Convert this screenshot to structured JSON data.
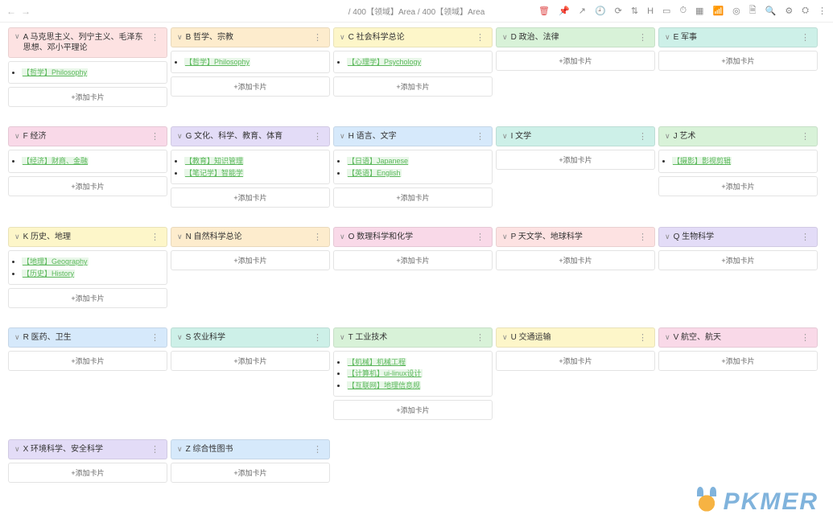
{
  "breadcrumb": {
    "sep": "/",
    "a": "400【领域】Area",
    "b": "400【领域】Area"
  },
  "add_label": "+添加卡片",
  "watermark": "PKMER",
  "toolbar_icons": [
    "trash",
    "pin",
    "share",
    "recent",
    "refresh",
    "sort",
    "h",
    "col",
    "clock",
    "grid",
    "wifi",
    "target",
    "doc",
    "search",
    "gear",
    "settings",
    "more"
  ],
  "lanes": [
    {
      "t": "A 马克思主义、列宁主义、毛泽东思想、邓小平理论",
      "c": "c-red",
      "tall": true,
      "items": [
        {
          "txt": "【哲学】Philosophy"
        }
      ]
    },
    {
      "t": "B 哲学、宗教",
      "c": "c-orange",
      "items": [
        {
          "txt": "【哲学】Philosophy"
        }
      ]
    },
    {
      "t": "C 社会科学总论",
      "c": "c-yellow",
      "items": [
        {
          "txt": "【心理学】Psychology"
        }
      ]
    },
    {
      "t": "D 政治、法律",
      "c": "c-green",
      "items": []
    },
    {
      "t": "E 军事",
      "c": "c-teal",
      "items": []
    },
    {
      "t": "F 经济",
      "c": "c-pink",
      "items": [
        {
          "txt": "【经济】财商、金融"
        }
      ]
    },
    {
      "t": "G 文化、科学、教育、体育",
      "c": "c-purple",
      "items": [
        {
          "txt": "【教育】知识管理"
        },
        {
          "txt": "【笔记学】智能学"
        }
      ]
    },
    {
      "t": "H 语言、文字",
      "c": "c-blue",
      "items": [
        {
          "txt": "【日语】Japanese"
        },
        {
          "txt": "【英语】English"
        }
      ]
    },
    {
      "t": "I 文学",
      "c": "c-teal",
      "items": []
    },
    {
      "t": "J 艺术",
      "c": "c-green",
      "items": [
        {
          "txt": "【摄影】影视剪辑"
        }
      ]
    },
    {
      "t": "K 历史、地理",
      "c": "c-yellow",
      "items": [
        {
          "txt": "【地理】Geography"
        },
        {
          "txt": "【历史】History"
        }
      ]
    },
    {
      "t": "N 自然科学总论",
      "c": "c-orange",
      "items": []
    },
    {
      "t": "O 数理科学和化学",
      "c": "c-pink",
      "items": []
    },
    {
      "t": "P 天文学、地球科学",
      "c": "c-red",
      "items": []
    },
    {
      "t": "Q 生物科学",
      "c": "c-purple",
      "items": []
    },
    {
      "t": "R 医药、卫生",
      "c": "c-blue",
      "items": []
    },
    {
      "t": "S 农业科学",
      "c": "c-teal",
      "items": []
    },
    {
      "t": "T 工业技术",
      "c": "c-green",
      "items": [
        {
          "txt": "【机械】机械工程"
        },
        {
          "txt": "【计算机】ui-linux设计"
        },
        {
          "txt": "【互联网】地理信息规"
        }
      ]
    },
    {
      "t": "U 交通运输",
      "c": "c-yellow",
      "items": []
    },
    {
      "t": "V 航空、航天",
      "c": "c-pink",
      "items": []
    },
    {
      "t": "X 环境科学、安全科学",
      "c": "c-purple",
      "items": []
    },
    {
      "t": "Z 综合性图书",
      "c": "c-blue",
      "items": []
    }
  ]
}
